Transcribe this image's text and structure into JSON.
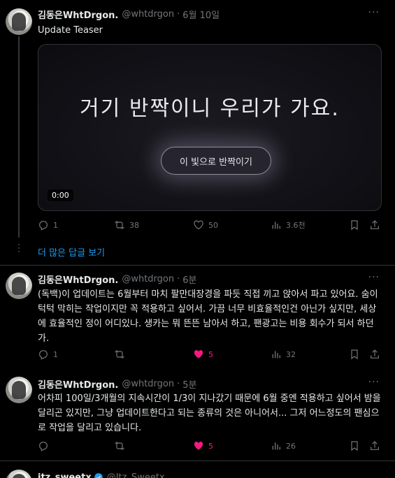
{
  "tweets": [
    {
      "name": "김동은WhtDrgon.",
      "handle": "@whtdrgon",
      "time": "6월 10일",
      "text": "Update Teaser",
      "media": {
        "headline": "거기 반짝이니 우리가 가요.",
        "button": "이 빛으로 반짝이기",
        "duration": "0:00"
      },
      "stats": {
        "replies": "1",
        "retweets": "38",
        "likes": "50",
        "views": "3.6천"
      },
      "liked": false
    },
    {
      "name": "김동은WhtDrgon.",
      "handle": "@whtdrgon",
      "time": "6분",
      "text": "(독백)이 업데이트는 6월부터 마치 팔만대장경을 파듯 직접 끼고 앉아서 파고 있어요. 숨이 턱턱 막히는 작업이지만 꼭 적용하고 싶어서. 가끔 너무 비효율적인건 아닌가 싶지만, 세상에 효율적인 정이 어디있나. 생카는 뭐 뜬뜬 남아서 하고, 팬광고는 비용 회수가 되서 하던가.",
      "stats": {
        "replies": "1",
        "retweets": "",
        "likes": "5",
        "views": "32"
      },
      "liked": true
    },
    {
      "name": "김동은WhtDrgon.",
      "handle": "@whtdrgon",
      "time": "5분",
      "text": "어차피 100일/3개월의 지속시간이 1/3이 지나갔기 때문에 6월 중엔 적용하고 싶어서 밤을 달리곤 있지만, 그냥 업데이트한다고 되는 종류의 것은 아니어서... 그저 어느정도의 팬심으로 작업을 달리고 있습니다.",
      "stats": {
        "replies": "",
        "retweets": "",
        "likes": "5",
        "views": "26"
      },
      "liked": true
    },
    {
      "name": "itz_sweetx",
      "handle": "@Itz_Sweetx"
    }
  ],
  "show_more": "더 많은 답글 보기",
  "icons": [
    "more-icon",
    "reply-icon",
    "retweet-icon",
    "like-icon",
    "views-icon",
    "bookmark-icon",
    "share-icon",
    "verified-icon"
  ],
  "colors": {
    "accent": "#1d9bf0",
    "like": "#f91880",
    "muted": "#71767b",
    "background": "#000000"
  }
}
